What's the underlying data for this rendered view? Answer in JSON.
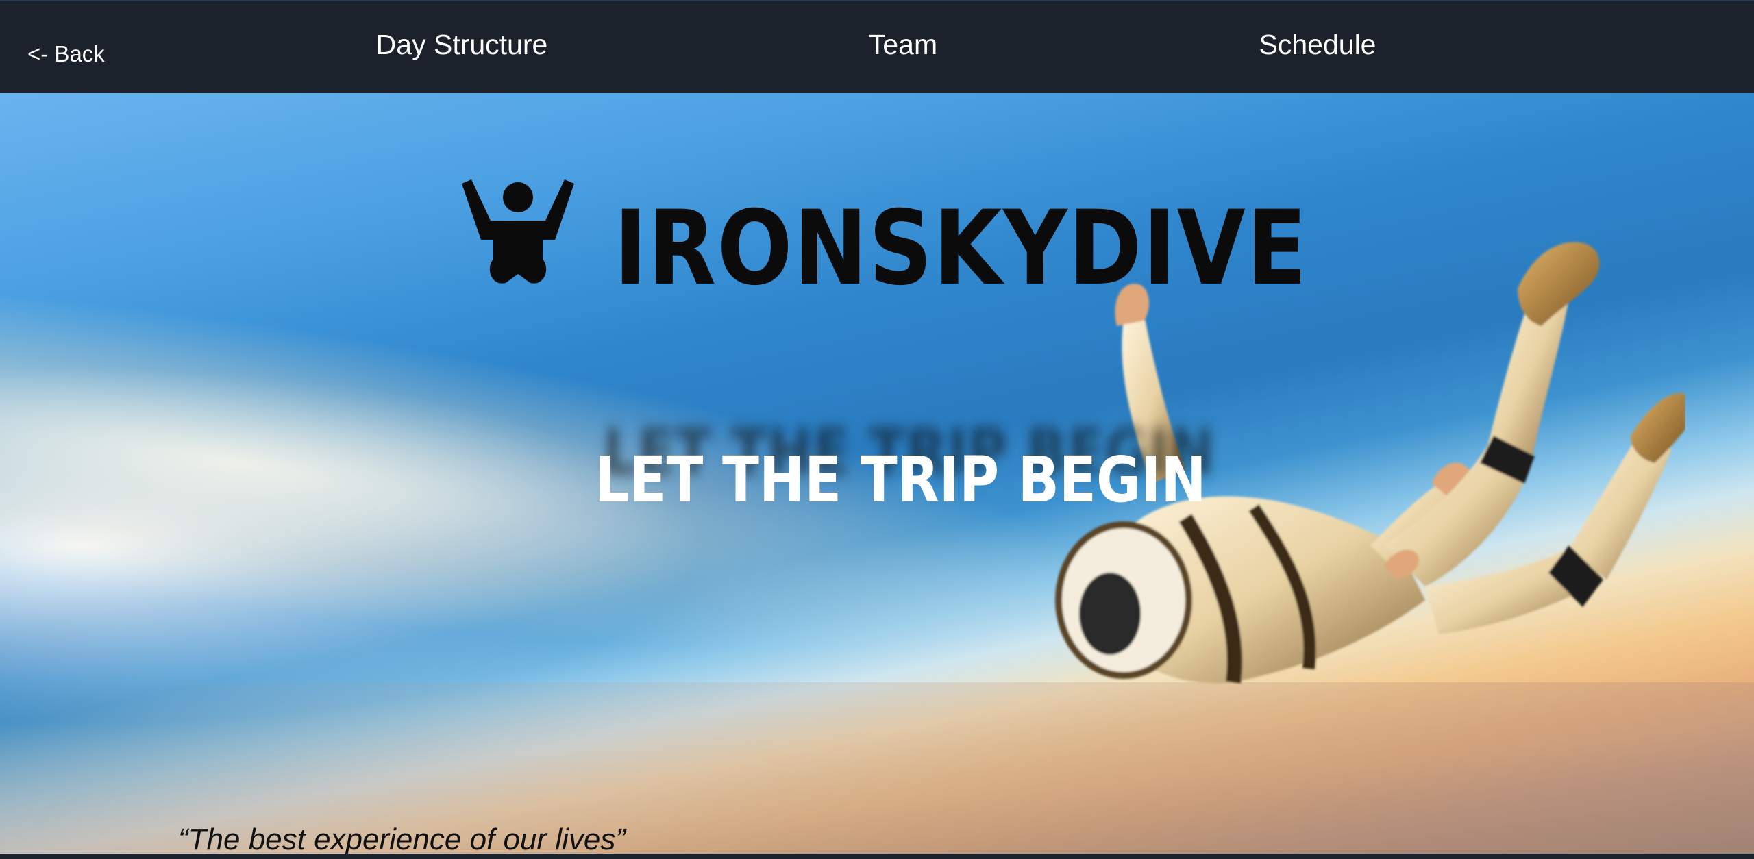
{
  "nav": {
    "back_label": "<- Back",
    "links": [
      {
        "label": "Day Structure"
      },
      {
        "label": "Team"
      },
      {
        "label": "Schedule"
      }
    ]
  },
  "hero": {
    "brand": "IRONSKYDIVE",
    "logo_icon": "skydiver-person-icon",
    "tagline": "LET THE TRIP BEGIN",
    "quote": "“The best experience of our lives”"
  },
  "colors": {
    "nav_background": "#1c222b",
    "nav_text": "#ffffff",
    "brand_text": "#0b0b0b",
    "tagline_text": "#ffffff",
    "sky_top": "#2f86cc",
    "horizon": "#f3c98e"
  }
}
